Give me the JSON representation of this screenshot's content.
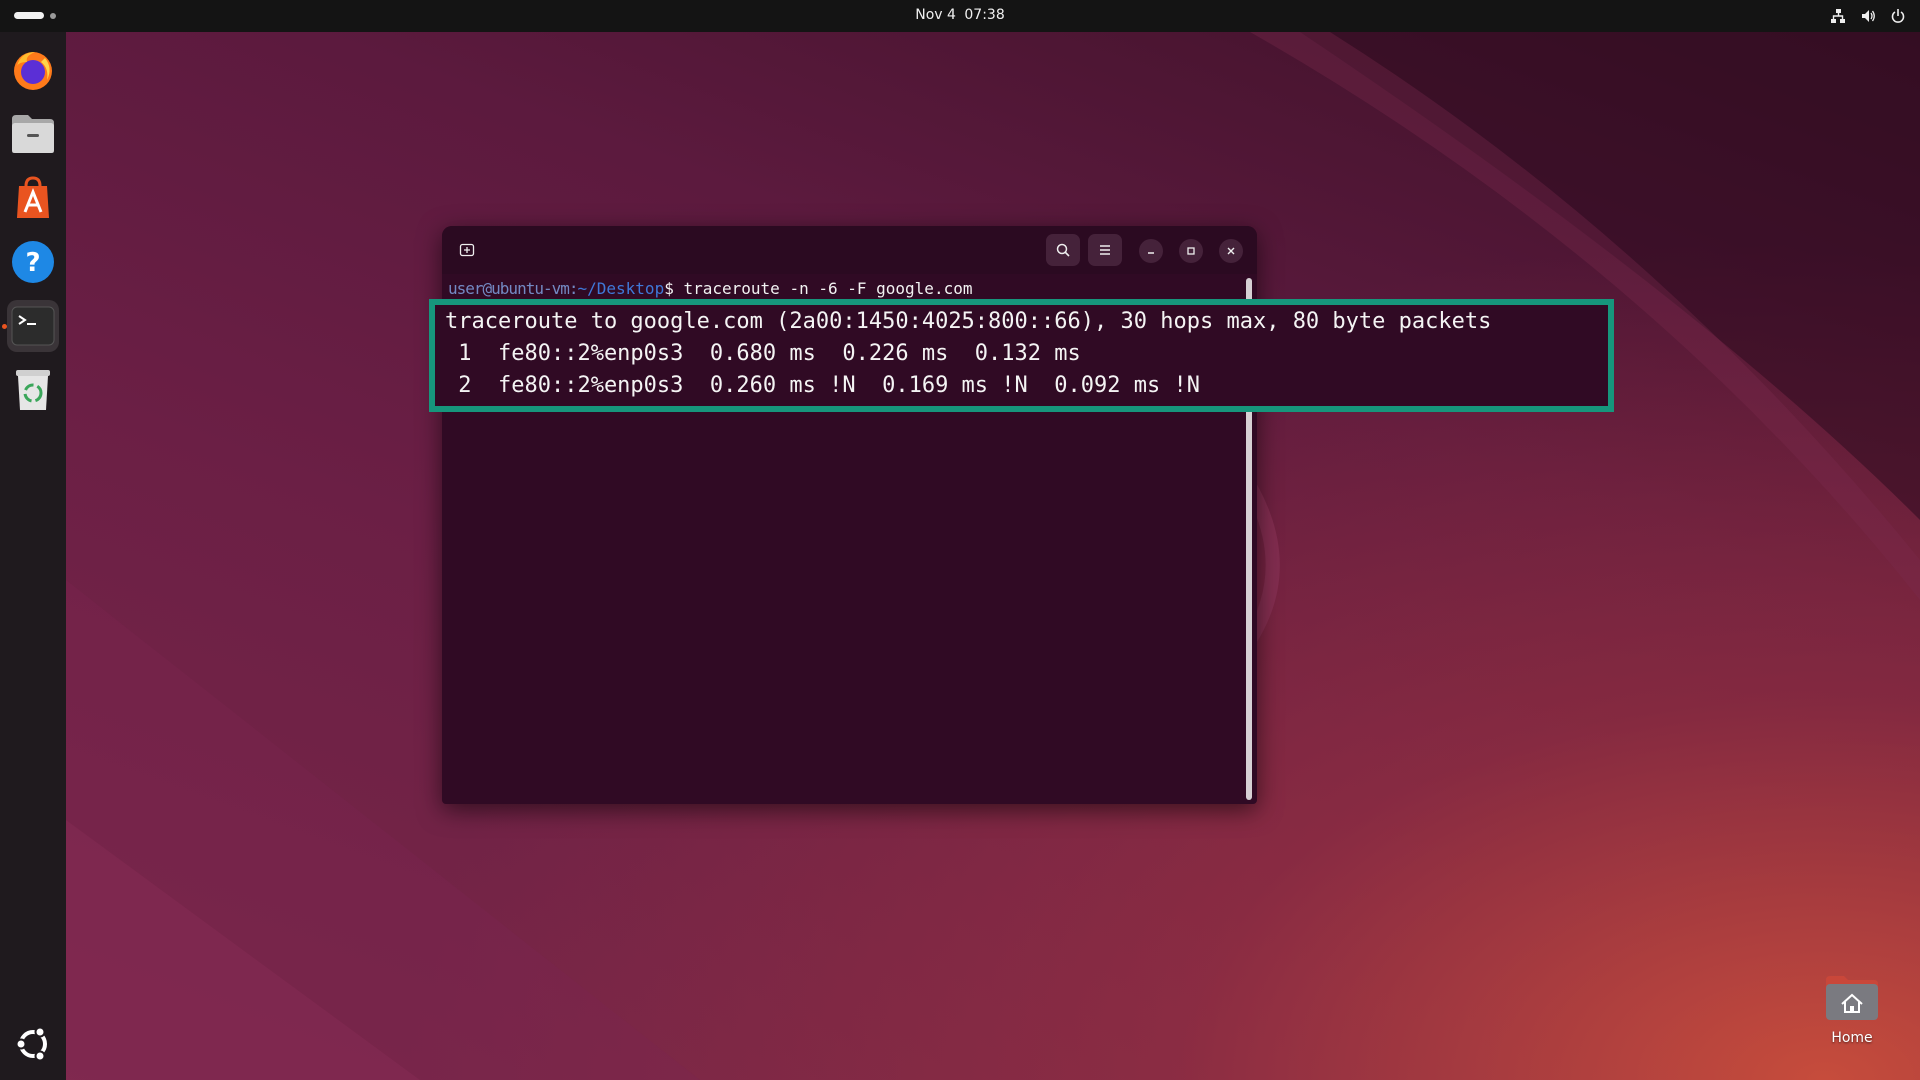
{
  "topbar": {
    "date": "Nov 4",
    "time": "07:38"
  },
  "dock": {
    "items": [
      {
        "name": "Firefox",
        "icon": "firefox-icon"
      },
      {
        "name": "Files",
        "icon": "files-icon"
      },
      {
        "name": "App Center",
        "icon": "app-center-icon"
      },
      {
        "name": "Help",
        "icon": "help-icon"
      },
      {
        "name": "Terminal",
        "icon": "terminal-icon",
        "active": true
      },
      {
        "name": "Trash",
        "icon": "trash-icon"
      }
    ],
    "show_apps_icon": "ubuntu-logo-icon"
  },
  "terminal": {
    "prompt_user": "user@ubuntu-vm:",
    "prompt_path": "~/Desktop",
    "prompt_symbol": "$",
    "command": "traceroute -n -6 -F google.com",
    "output_lines": [
      "traceroute to google.com (2a00:1450:4025:800::66), 30 hops max, 80 byte packets",
      " 1  fe80::2%enp0s3  0.680 ms  0.226 ms  0.132 ms",
      " 2  fe80::2%enp0s3  0.260 ms !N  0.169 ms !N  0.092 ms !N"
    ]
  },
  "desktop": {
    "home_label": "Home"
  },
  "colors": {
    "terminal_bg": "#300a24",
    "highlight_border": "#16967c",
    "prompt_path": "#3f78d8",
    "ubuntu_orange": "#e95420"
  }
}
